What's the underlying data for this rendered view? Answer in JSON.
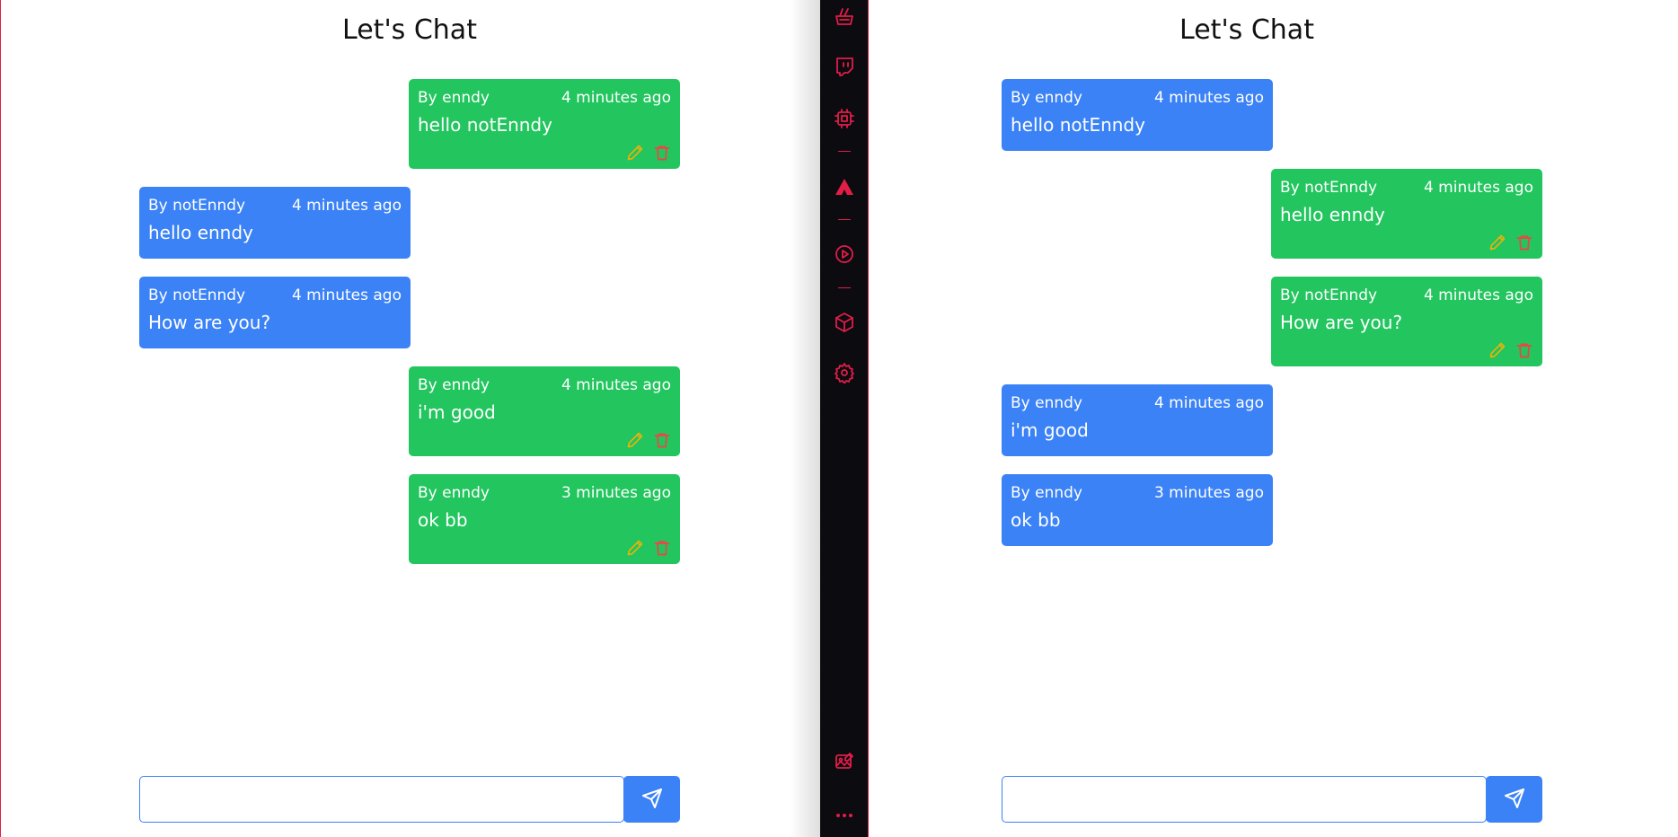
{
  "left_window": {
    "title": "Let's Chat",
    "messages": [
      {
        "author": "By enndy",
        "time": "4 minutes ago",
        "text": "hello notEnndy"
      },
      {
        "author": "By notEnndy",
        "time": "4 minutes ago",
        "text": "hello enndy"
      },
      {
        "author": "By notEnndy",
        "time": "4 minutes ago",
        "text": "How are you?"
      },
      {
        "author": "By enndy",
        "time": "4 minutes ago",
        "text": "i'm good"
      },
      {
        "author": "By enndy",
        "time": "3 minutes ago",
        "text": "ok bb"
      }
    ],
    "input": {
      "value": "",
      "placeholder": ""
    }
  },
  "right_window": {
    "title": "Let's Chat",
    "messages": [
      {
        "author": "By enndy",
        "time": "4 minutes ago",
        "text": "hello notEnndy"
      },
      {
        "author": "By notEnndy",
        "time": "4 minutes ago",
        "text": "hello enndy"
      },
      {
        "author": "By notEnndy",
        "time": "4 minutes ago",
        "text": "How are you?"
      },
      {
        "author": "By enndy",
        "time": "4 minutes ago",
        "text": "i'm good"
      },
      {
        "author": "By enndy",
        "time": "3 minutes ago",
        "text": "ok bb"
      }
    ],
    "input": {
      "value": "",
      "placeholder": ""
    }
  },
  "colors": {
    "own_message": "#22c55e",
    "other_message": "#3b82f6",
    "accent": "#e11d48",
    "dock_background": "#0b0b10",
    "edit_icon": "#eab308",
    "delete_icon": "#ef4444"
  },
  "icons": {
    "send": "send-icon",
    "edit": "pencil-icon",
    "delete": "trash-icon",
    "dock": [
      "basket-icon",
      "twitch-icon",
      "cpu-chip-icon",
      "triangle-logo-icon",
      "play-circle-icon",
      "cube-icon",
      "gear-icon",
      "image-edit-icon",
      "more-dots-icon"
    ]
  }
}
